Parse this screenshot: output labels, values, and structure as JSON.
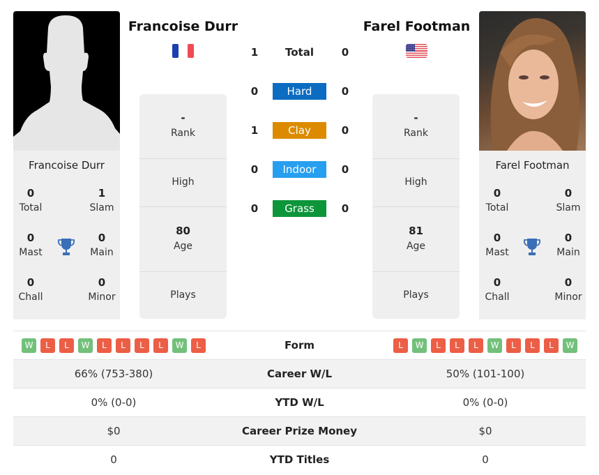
{
  "colors": {
    "hard": "#0b6cc2",
    "clay": "#dc8b00",
    "indoor": "#279ff0",
    "grass": "#0c9539",
    "win": "#72c07a",
    "loss": "#ec5e45",
    "trophy": "#3a6fb7"
  },
  "player1": {
    "name": "Francoise Durr",
    "country_flag": "france-flag",
    "photo": "silhouette-placeholder",
    "titles": {
      "total": {
        "value": "0",
        "label": "Total"
      },
      "slam": {
        "value": "1",
        "label": "Slam"
      },
      "mast": {
        "value": "0",
        "label": "Mast"
      },
      "main": {
        "value": "0",
        "label": "Main"
      },
      "chall": {
        "value": "0",
        "label": "Chall"
      },
      "minor": {
        "value": "0",
        "label": "Minor"
      }
    },
    "info": {
      "rank": {
        "value": "-",
        "label": "Rank"
      },
      "high": {
        "value": "",
        "label": "High"
      },
      "age": {
        "value": "80",
        "label": "Age"
      },
      "plays": {
        "value": "",
        "label": "Plays"
      }
    },
    "form": [
      "W",
      "L",
      "L",
      "W",
      "L",
      "L",
      "L",
      "L",
      "W",
      "L"
    ],
    "career_wl": "66% (753-380)",
    "ytd_wl": "0% (0-0)",
    "career_prize": "$0",
    "ytd_titles": "0"
  },
  "player2": {
    "name": "Farel Footman",
    "country_flag": "usa-flag",
    "photo": "player-photo",
    "titles": {
      "total": {
        "value": "0",
        "label": "Total"
      },
      "slam": {
        "value": "0",
        "label": "Slam"
      },
      "mast": {
        "value": "0",
        "label": "Mast"
      },
      "main": {
        "value": "0",
        "label": "Main"
      },
      "chall": {
        "value": "0",
        "label": "Chall"
      },
      "minor": {
        "value": "0",
        "label": "Minor"
      }
    },
    "info": {
      "rank": {
        "value": "-",
        "label": "Rank"
      },
      "high": {
        "value": "",
        "label": "High"
      },
      "age": {
        "value": "81",
        "label": "Age"
      },
      "plays": {
        "value": "",
        "label": "Plays"
      }
    },
    "form": [
      "L",
      "W",
      "L",
      "L",
      "L",
      "W",
      "L",
      "L",
      "L",
      "W"
    ],
    "career_wl": "50% (101-100)",
    "ytd_wl": "0% (0-0)",
    "career_prize": "$0",
    "ytd_titles": "0"
  },
  "h2h": {
    "total": {
      "label": "Total",
      "p1": "1",
      "p2": "0"
    },
    "surfaces": [
      {
        "label": "Hard",
        "p1": "0",
        "p2": "0"
      },
      {
        "label": "Clay",
        "p1": "1",
        "p2": "0"
      },
      {
        "label": "Indoor",
        "p1": "0",
        "p2": "0"
      },
      {
        "label": "Grass",
        "p1": "0",
        "p2": "0"
      }
    ]
  },
  "table": {
    "form_label": "Form",
    "career_wl_label": "Career W/L",
    "ytd_wl_label": "YTD W/L",
    "career_prize_label": "Career Prize Money",
    "ytd_titles_label": "YTD Titles"
  }
}
